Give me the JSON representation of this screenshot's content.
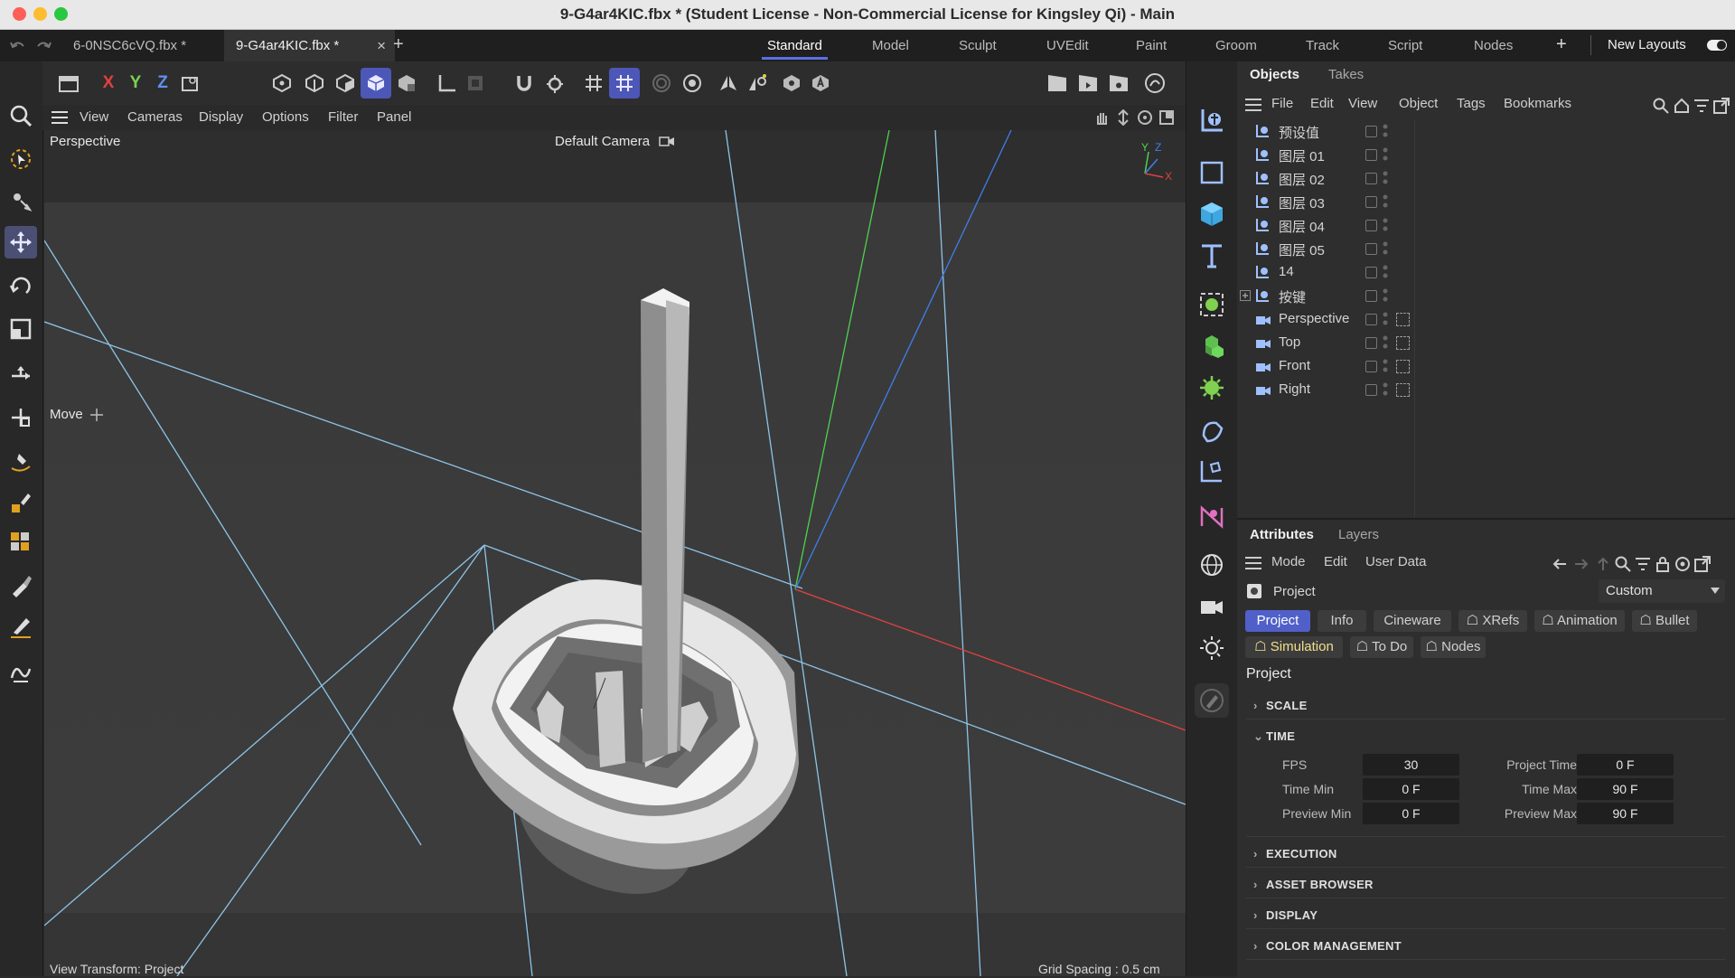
{
  "window": {
    "title": "9-G4ar4KIC.fbx * (Student License - Non-Commercial License for Kingsley Qi) - Main",
    "traffic_colors": [
      "#fe5f57",
      "#febc2e",
      "#28c840"
    ]
  },
  "doc_tabs": [
    {
      "label": "6-0NSC6cVQ.fbx *"
    },
    {
      "label": "9-G4ar4KIC.fbx *"
    }
  ],
  "tabbar_controls": {
    "close": "×",
    "add": "+"
  },
  "layouts": [
    {
      "label": "Standard"
    },
    {
      "label": "Model"
    },
    {
      "label": "Sculpt"
    },
    {
      "label": "UVEdit"
    },
    {
      "label": "Paint"
    },
    {
      "label": "Groom"
    },
    {
      "label": "Track"
    },
    {
      "label": "Script"
    },
    {
      "label": "Nodes"
    }
  ],
  "new_layouts": {
    "add": "+",
    "label": "New Layouts"
  },
  "axis_lock": {
    "x": "X",
    "y": "Y",
    "z": "Z"
  },
  "viewport_menu": [
    "View",
    "Cameras",
    "Display",
    "Options",
    "Filter",
    "Panel"
  ],
  "viewport": {
    "name": "Perspective",
    "camera": "Default Camera",
    "tool_hud": "Move",
    "status_left": "View Transform: Project",
    "status_right": "Grid Spacing : 0.5 cm",
    "axis_labels": {
      "x": "X",
      "y": "Y",
      "z": "Z"
    }
  },
  "objects_panel": {
    "tabs": [
      "Objects",
      "Takes"
    ],
    "menu": [
      "File",
      "Edit",
      "View",
      "Object",
      "Tags",
      "Bookmarks"
    ],
    "rows": [
      {
        "name": "预设值",
        "type": "layer"
      },
      {
        "name": "图层 01",
        "type": "layer"
      },
      {
        "name": "图层 02",
        "type": "layer"
      },
      {
        "name": "图层 03",
        "type": "layer"
      },
      {
        "name": "图层 04",
        "type": "layer"
      },
      {
        "name": "图层 05",
        "type": "layer"
      },
      {
        "name": "14",
        "type": "layer"
      },
      {
        "name": "按键",
        "type": "layer-group"
      },
      {
        "name": "Perspective",
        "type": "camera"
      },
      {
        "name": "Top",
        "type": "camera"
      },
      {
        "name": "Front",
        "type": "camera"
      },
      {
        "name": "Right",
        "type": "camera"
      }
    ]
  },
  "attributes_panel": {
    "tabs": [
      "Attributes",
      "Layers"
    ],
    "menu": [
      "Mode",
      "Edit",
      "User Data"
    ],
    "object_label": "Project",
    "mode_select": "Custom",
    "pills_row1": [
      "Project",
      "Info",
      "Cineware",
      "XRefs",
      "Animation",
      "Bullet"
    ],
    "pills_row2": [
      "Simulation",
      "To Do",
      "Nodes"
    ],
    "heading": "Project",
    "sections": {
      "scale": "SCALE",
      "time": "TIME",
      "execution": "EXECUTION",
      "asset_browser": "ASSET BROWSER",
      "display": "DISPLAY",
      "color_management": "COLOR MANAGEMENT"
    },
    "time_fields": {
      "fps_label": "FPS",
      "fps": "30",
      "project_time_label": "Project Time",
      "project_time": "0 F",
      "time_min_label": "Time Min",
      "time_min": "0 F",
      "time_max_label": "Time Max",
      "time_max": "90 F",
      "preview_min_label": "Preview Min",
      "preview_min": "0 F",
      "preview_max_label": "Preview Max",
      "preview_max": "90 F"
    }
  },
  "colors": {
    "accent": "#5b6fe0",
    "axis_x": "#e0413f",
    "axis_y": "#4fd14f",
    "axis_z": "#3f7fe8"
  }
}
